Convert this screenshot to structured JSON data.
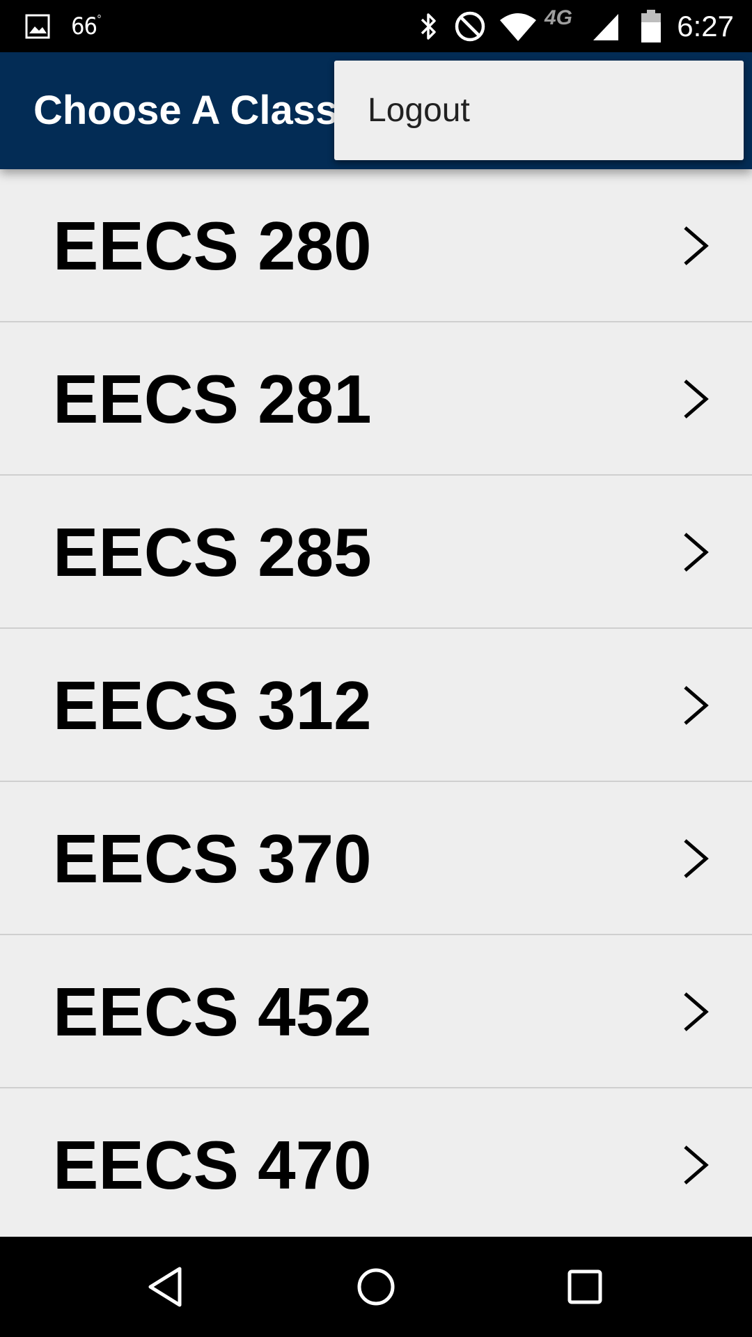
{
  "status_bar": {
    "temperature": "66",
    "temperature_unit": "°",
    "network_label": "4G",
    "clock": "6:27",
    "icons": [
      "gallery-icon",
      "bluetooth-icon",
      "do-not-disturb-icon",
      "wifi-icon",
      "signal-icon",
      "battery-icon"
    ]
  },
  "app_bar": {
    "title": "Choose A Class",
    "background_color": "#032c55"
  },
  "overflow_menu": {
    "items": [
      {
        "label": "Logout"
      }
    ]
  },
  "class_list": {
    "items": [
      {
        "label": "EECS 280"
      },
      {
        "label": "EECS 281"
      },
      {
        "label": "EECS 285"
      },
      {
        "label": "EECS 312"
      },
      {
        "label": "EECS 370"
      },
      {
        "label": "EECS 452"
      },
      {
        "label": "EECS 470"
      }
    ]
  },
  "nav_bar": {
    "icons": [
      "back-icon",
      "home-icon",
      "recent-apps-icon"
    ]
  }
}
